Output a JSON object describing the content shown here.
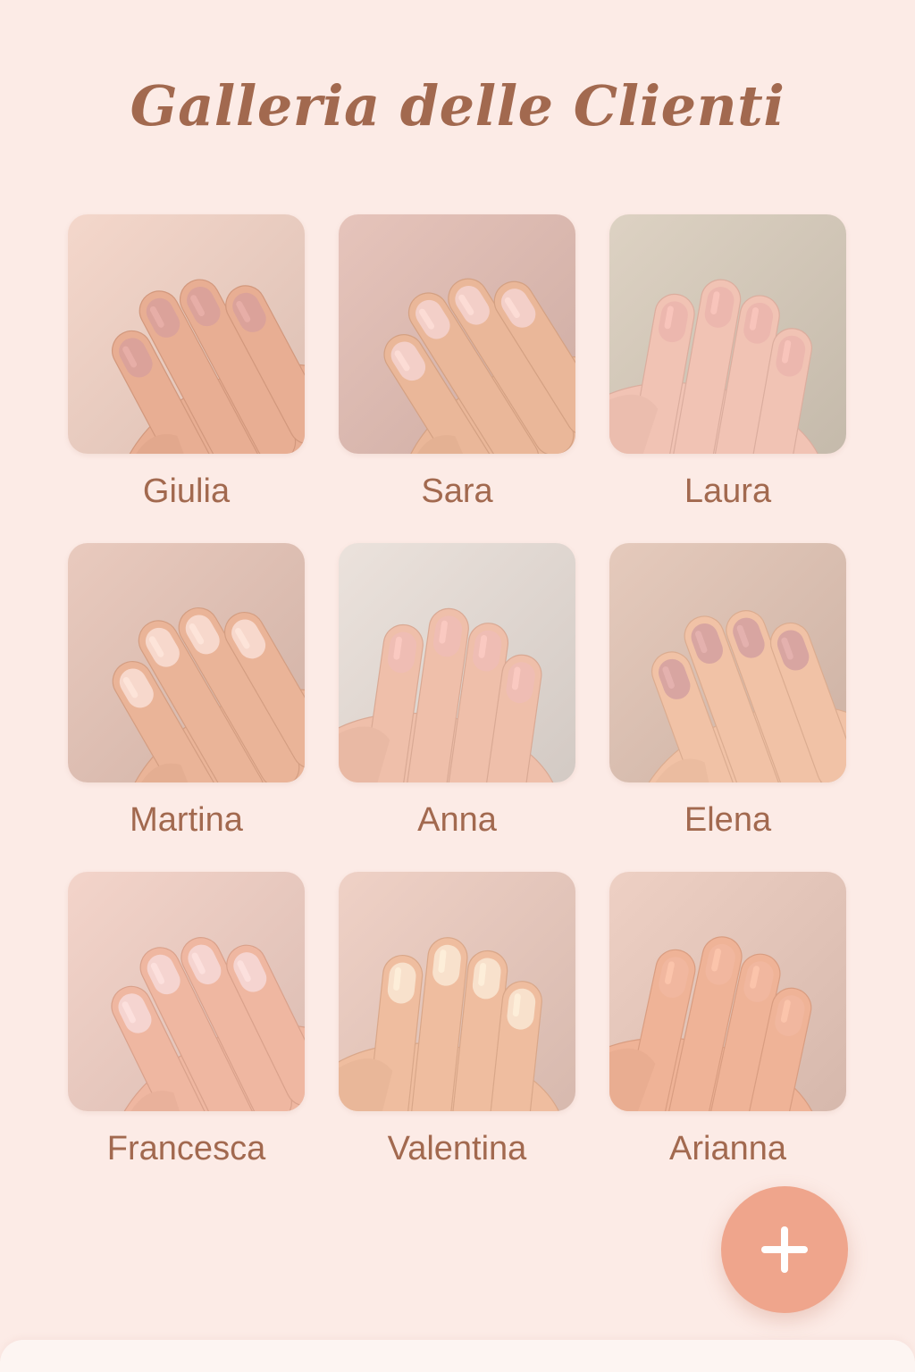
{
  "header": {
    "title": "Galleria delle Clienti"
  },
  "gallery": {
    "clients": [
      {
        "name": "Giulia",
        "bg": "#e6c9bd",
        "skin": "#e8ae93",
        "nail": "#dba29a"
      },
      {
        "name": "Sara",
        "bg": "#d8b6ad",
        "skin": "#eab799",
        "nail": "#f3cfc8"
      },
      {
        "name": "Laura",
        "bg": "#cfc4b5",
        "skin": "#f1c3b4",
        "nail": "#ecb7ae"
      },
      {
        "name": "Martina",
        "bg": "#dbbcb0",
        "skin": "#eab498",
        "nail": "#f7d8cc"
      },
      {
        "name": "Anna",
        "bg": "#ddd4ce",
        "skin": "#efbfaa",
        "nail": "#efbdb4"
      },
      {
        "name": "Elena",
        "bg": "#d7bcae",
        "skin": "#f1c2a6",
        "nail": "#d8a5a1"
      },
      {
        "name": "Francesca",
        "bg": "#e5c6bc",
        "skin": "#efb7a1",
        "nail": "#f5d4d0"
      },
      {
        "name": "Valentina",
        "bg": "#e1c3b8",
        "skin": "#efbd9f",
        "nail": "#f8e1cc"
      },
      {
        "name": "Arianna",
        "bg": "#e0c2b6",
        "skin": "#efb397",
        "nail": "#f1b79f"
      }
    ]
  },
  "actions": {
    "add_icon": "plus-icon",
    "add_color": "#efa58c"
  },
  "theme": {
    "background": "#fcebe6",
    "accent_text": "#a2694f"
  }
}
